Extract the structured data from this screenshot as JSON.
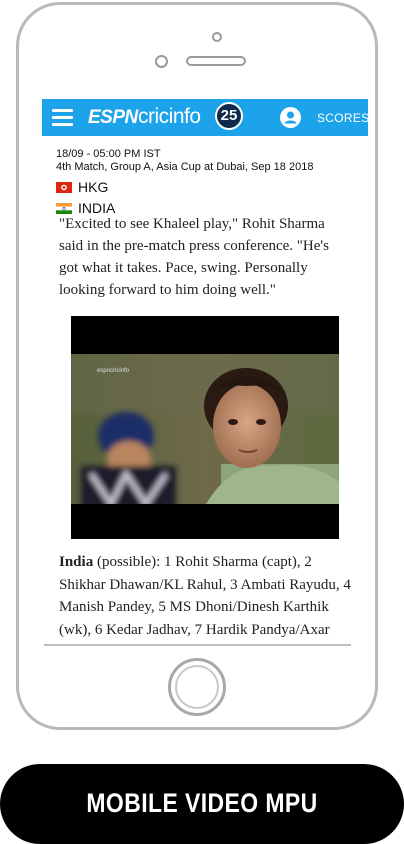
{
  "header": {
    "logo_espn": "ESPN",
    "logo_cricinfo": "cricinfo",
    "logo_badge": "25",
    "scores_label": "SCORES"
  },
  "match": {
    "time": "18/09 - 05:00 PM IST",
    "description": "4th Match, Group A, Asia Cup at Dubai, Sep 18 2018",
    "teams": [
      {
        "name": "HKG",
        "flag": "hong-kong-flag-icon"
      },
      {
        "name": "INDIA",
        "flag": "india-flag-icon"
      }
    ]
  },
  "article": {
    "paragraph1": "\"Excited to see Khaleel play,\" Rohit Sharma said in the pre-match press conference. \"He's got what it takes. Pace, swing. Personally looking forward to him doing well.\"",
    "paragraph2_bold": "India",
    "paragraph2_rest": " (possible): 1 Rohit Sharma (capt), 2 Shikhar Dhawan/KL Rahul, 3 Ambati Rayudu, 4 Manish Pandey, 5 MS Dhoni/Dinesh Karthik (wk), 6 Kedar Jadhav, 7 Hardik Pandya/Axar"
  },
  "video": {
    "watermark": "espncricinfo"
  },
  "banner": {
    "label": "MOBILE VIDEO MPU"
  },
  "colors": {
    "topbar": "#1ca3e9",
    "banner": "#000000"
  }
}
